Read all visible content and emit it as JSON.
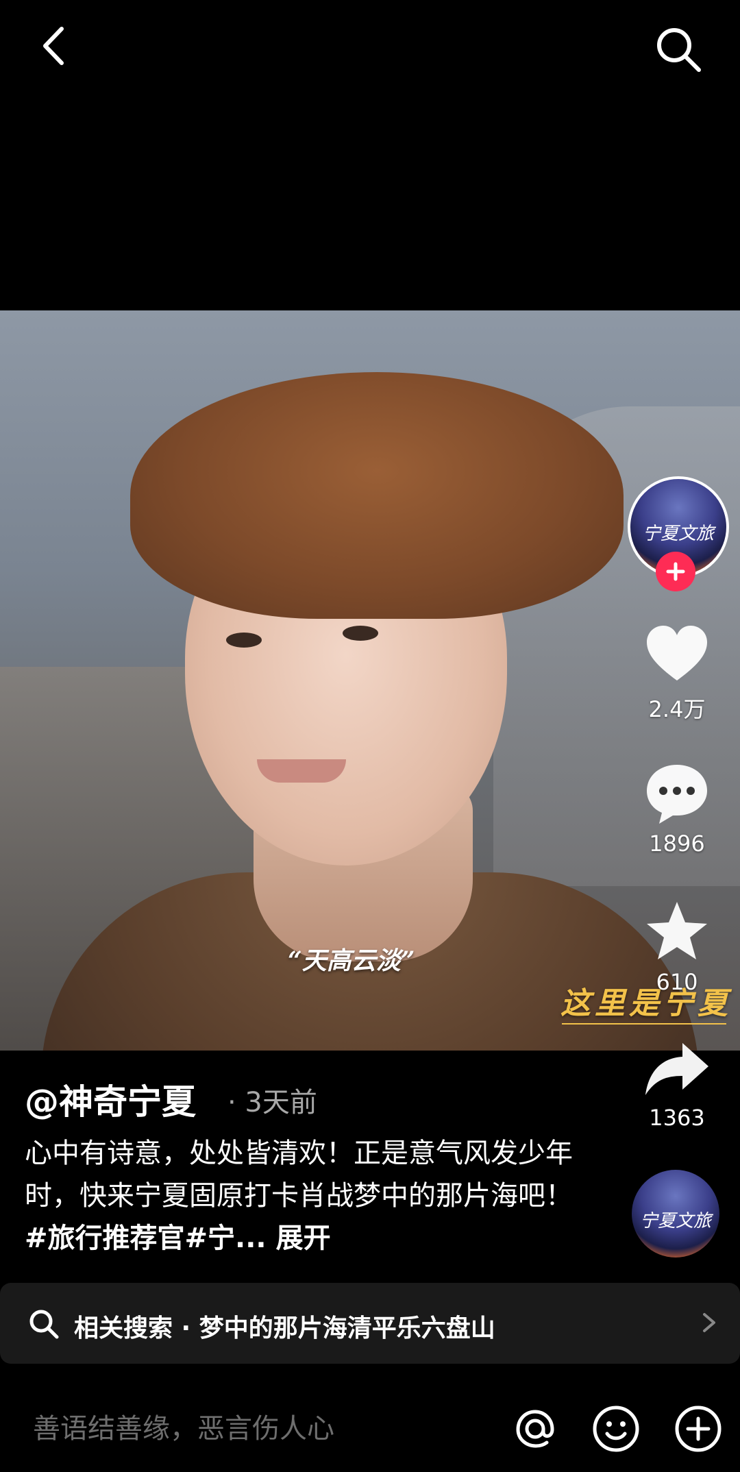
{
  "video": {
    "caption": "“天高云淡”",
    "watermark": "这里是宁夏"
  },
  "creator": {
    "avatar_text": "宁夏文旅"
  },
  "rail": {
    "likes": "2.4万",
    "comments": "1896",
    "favorites": "610",
    "shares": "1363"
  },
  "post": {
    "author": "@神奇宁夏",
    "time": "· 3天前",
    "description": "心中有诗意，处处皆清欢！正是意气风发少年时，快来宁夏固原打卡肖战梦中的那片海吧！",
    "tags": "#旅行推荐官#宁...",
    "expand": "展开"
  },
  "related": {
    "label": "相关搜索 · 梦中的那片海清平乐六盘山"
  },
  "comment": {
    "placeholder": "善语结善缘，恶言伤人心"
  },
  "colors": {
    "accent_pink": "#fe2c55",
    "watermark_gold": "#f3c24a"
  }
}
